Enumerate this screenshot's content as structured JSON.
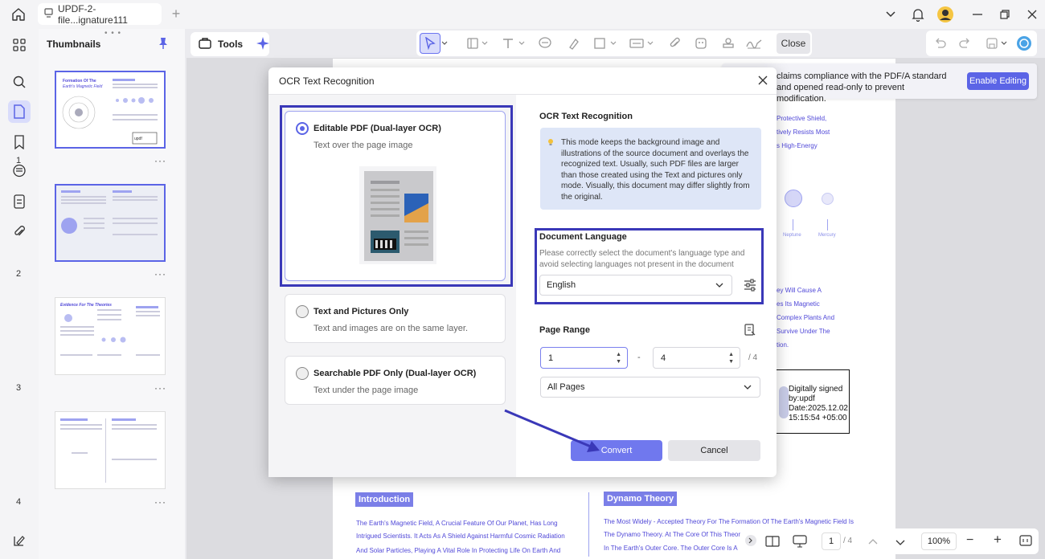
{
  "titlebar": {
    "tab_title": "UPDF-2-file...ignature111",
    "add_tab": "+"
  },
  "thumbnails": {
    "title": "Thumbnails",
    "grip": "• • •",
    "pages": [
      {
        "num": "1",
        "more": "···"
      },
      {
        "num": "2",
        "more": "···"
      },
      {
        "num": "3",
        "more": "···"
      },
      {
        "num": "4",
        "more": "···"
      }
    ]
  },
  "toolbar": {
    "tools_label": "Tools",
    "close_label": "Close"
  },
  "notice": {
    "text": "claims compliance with the PDF/A standard and opened read-only to prevent modification.",
    "enable_label": "Enable Editing"
  },
  "document": {
    "right_lines": [
      "Protective Shield,",
      "tively Resists Most",
      "s High-Energy"
    ],
    "planet_labels": [
      "Neptune",
      "Mercury"
    ],
    "right_lines_2": [
      "ey Will Cause A",
      "es Its Magnetic",
      "Complex Plants And",
      "Survive Under The",
      "tion."
    ],
    "signature": "Digitally signed by:updf Date:2025.12.02 15:15:54 +05:00",
    "intro_heading": "Introduction",
    "intro_lines": [
      "The Earth's Magnetic Field, A Crucial Feature Of Our Planet, Has Long",
      "Intrigued Scientists. It Acts As A Shield Against Harmful Cosmic Radiation",
      "And Solar Particles, Playing A Vital Role In Protecting Life On Earth And"
    ],
    "dynamo_heading": "Dynamo Theory",
    "dynamo_lines": [
      "The Most Widely - Accepted Theory For The Formation Of The Earth's Magnetic Field Is",
      "The Dynamo Theory. At The Core Of This Theor",
      "In The Earth's Outer Core. The Outer Core Is A"
    ]
  },
  "bottombar": {
    "page_current": "1",
    "page_total": "/ 4",
    "zoom": "100%"
  },
  "dialog": {
    "title": "OCR Text Recognition",
    "options": [
      {
        "title": "Editable PDF (Dual-layer OCR)",
        "desc": "Text over the page image",
        "selected": true
      },
      {
        "title": "Text and Pictures Only",
        "desc": "Text and images are on the same layer.",
        "selected": false
      },
      {
        "title": "Searchable PDF Only (Dual-layer OCR)",
        "desc": "Text under the page image",
        "selected": false
      }
    ],
    "right_heading": "OCR Text Recognition",
    "info": "This mode keeps the background image and illustrations of the source document and overlays the recognized text. Usually, such PDF files are larger than those created using the Text and pictures only mode. Visually, this document may differ slightly from the original.",
    "lang_heading": "Document Language",
    "lang_desc": "Please correctly select the document's language type and avoid selecting languages not present in the document",
    "lang_value": "English",
    "range_heading": "Page Range",
    "range_from": "1",
    "range_dash": "-",
    "range_to": "4",
    "range_total": "/ 4",
    "range_select": "All Pages",
    "convert_label": "Convert",
    "cancel_label": "Cancel"
  },
  "colors": {
    "accent": "#5b64e6",
    "highlight": "#3a38b8",
    "doc_text": "#5048d8"
  }
}
